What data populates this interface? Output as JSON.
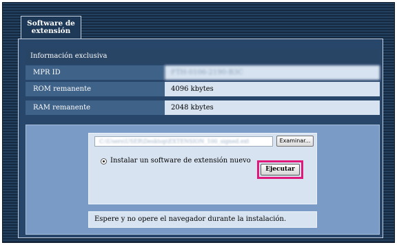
{
  "tab": {
    "label": "Software de extensión"
  },
  "info": {
    "header": "Información exclusiva",
    "rows": [
      {
        "label": "MPR ID",
        "value": "FTH-0106-2190-B3C"
      },
      {
        "label": "ROM remanente",
        "value": "4096 kbytes"
      },
      {
        "label": "RAM remanente",
        "value": "2048 kbytes"
      }
    ]
  },
  "install": {
    "file_path": "C:\\Users\\USER\\Desktop\\EXTENSION_100_signed.ext",
    "browse_label": "Examinar...",
    "radio_label": "Instalar un software de extensión nuevo",
    "radio_selected": true,
    "execute_label": "Ejecutar",
    "highlight_color": "#e0187a"
  },
  "notice": "Espere y no opere el navegador durante la instalación."
}
